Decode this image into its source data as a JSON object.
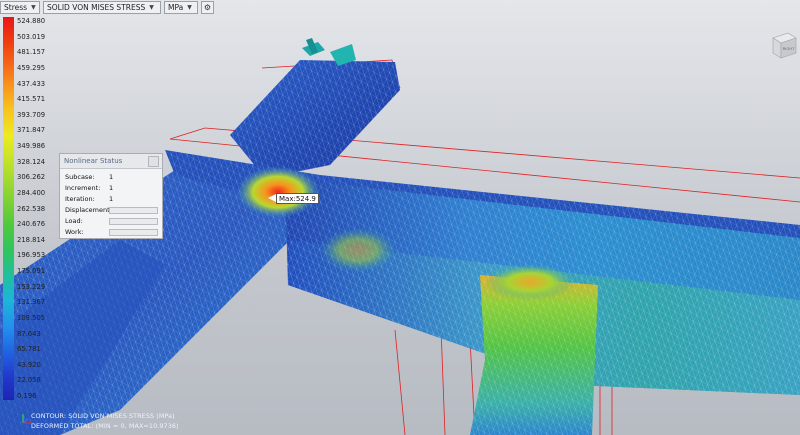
{
  "toolbar": {
    "result_type": "Stress",
    "component": "SOLID VON MISES STRESS",
    "units": "MPa",
    "settings_icon": "gear-icon"
  },
  "legend": {
    "values": [
      "524.880",
      "503.019",
      "481.157",
      "459.295",
      "437.433",
      "415.571",
      "393.709",
      "371.847",
      "349.986",
      "328.124",
      "306.262",
      "284.400",
      "262.538",
      "240.676",
      "218.814",
      "196.953",
      "175.091",
      "153.229",
      "131.367",
      "109.505",
      "87.643",
      "65.781",
      "43.920",
      "22.058",
      "0.196"
    ]
  },
  "nonlinear_status": {
    "title": "Nonlinear Status",
    "subcase_label": "Subcase:",
    "subcase_value": "1",
    "increment_label": "Increment:",
    "increment_value": "1",
    "iteration_label": "Iteration:",
    "iteration_value": "1",
    "displacement_label": "Displacement:",
    "load_label": "Load:",
    "work_label": "Work:"
  },
  "probe": {
    "label": "Max:524.9"
  },
  "footer": {
    "contour": "CONTOUR: SOLID VON MISES STRESS (MPa)",
    "deformed": "DEFORMED TOTAL: (MIN = 0, MAX=10.9736)"
  },
  "viewcube": {
    "face_label": "RIGHT"
  },
  "colors": {
    "max": "#e8141a",
    "mid": "#52c93c",
    "min": "#1e24b4",
    "outline": "#e02020"
  }
}
